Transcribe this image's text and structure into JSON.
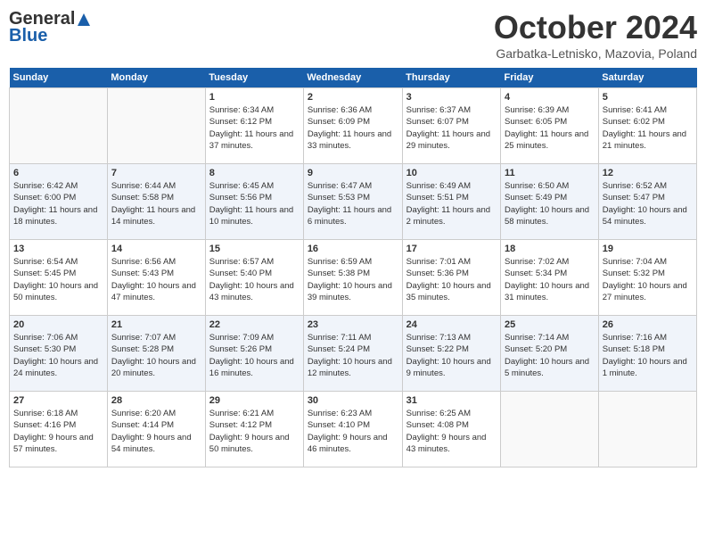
{
  "header": {
    "logo_general": "General",
    "logo_blue": "Blue",
    "month_title": "October 2024",
    "location": "Garbatka-Letnisko, Mazovia, Poland"
  },
  "days_of_week": [
    "Sunday",
    "Monday",
    "Tuesday",
    "Wednesday",
    "Thursday",
    "Friday",
    "Saturday"
  ],
  "weeks": [
    [
      {
        "num": "",
        "sunrise": "",
        "sunset": "",
        "daylight": ""
      },
      {
        "num": "",
        "sunrise": "",
        "sunset": "",
        "daylight": ""
      },
      {
        "num": "1",
        "sunrise": "Sunrise: 6:34 AM",
        "sunset": "Sunset: 6:12 PM",
        "daylight": "Daylight: 11 hours and 37 minutes."
      },
      {
        "num": "2",
        "sunrise": "Sunrise: 6:36 AM",
        "sunset": "Sunset: 6:09 PM",
        "daylight": "Daylight: 11 hours and 33 minutes."
      },
      {
        "num": "3",
        "sunrise": "Sunrise: 6:37 AM",
        "sunset": "Sunset: 6:07 PM",
        "daylight": "Daylight: 11 hours and 29 minutes."
      },
      {
        "num": "4",
        "sunrise": "Sunrise: 6:39 AM",
        "sunset": "Sunset: 6:05 PM",
        "daylight": "Daylight: 11 hours and 25 minutes."
      },
      {
        "num": "5",
        "sunrise": "Sunrise: 6:41 AM",
        "sunset": "Sunset: 6:02 PM",
        "daylight": "Daylight: 11 hours and 21 minutes."
      }
    ],
    [
      {
        "num": "6",
        "sunrise": "Sunrise: 6:42 AM",
        "sunset": "Sunset: 6:00 PM",
        "daylight": "Daylight: 11 hours and 18 minutes."
      },
      {
        "num": "7",
        "sunrise": "Sunrise: 6:44 AM",
        "sunset": "Sunset: 5:58 PM",
        "daylight": "Daylight: 11 hours and 14 minutes."
      },
      {
        "num": "8",
        "sunrise": "Sunrise: 6:45 AM",
        "sunset": "Sunset: 5:56 PM",
        "daylight": "Daylight: 11 hours and 10 minutes."
      },
      {
        "num": "9",
        "sunrise": "Sunrise: 6:47 AM",
        "sunset": "Sunset: 5:53 PM",
        "daylight": "Daylight: 11 hours and 6 minutes."
      },
      {
        "num": "10",
        "sunrise": "Sunrise: 6:49 AM",
        "sunset": "Sunset: 5:51 PM",
        "daylight": "Daylight: 11 hours and 2 minutes."
      },
      {
        "num": "11",
        "sunrise": "Sunrise: 6:50 AM",
        "sunset": "Sunset: 5:49 PM",
        "daylight": "Daylight: 10 hours and 58 minutes."
      },
      {
        "num": "12",
        "sunrise": "Sunrise: 6:52 AM",
        "sunset": "Sunset: 5:47 PM",
        "daylight": "Daylight: 10 hours and 54 minutes."
      }
    ],
    [
      {
        "num": "13",
        "sunrise": "Sunrise: 6:54 AM",
        "sunset": "Sunset: 5:45 PM",
        "daylight": "Daylight: 10 hours and 50 minutes."
      },
      {
        "num": "14",
        "sunrise": "Sunrise: 6:56 AM",
        "sunset": "Sunset: 5:43 PM",
        "daylight": "Daylight: 10 hours and 47 minutes."
      },
      {
        "num": "15",
        "sunrise": "Sunrise: 6:57 AM",
        "sunset": "Sunset: 5:40 PM",
        "daylight": "Daylight: 10 hours and 43 minutes."
      },
      {
        "num": "16",
        "sunrise": "Sunrise: 6:59 AM",
        "sunset": "Sunset: 5:38 PM",
        "daylight": "Daylight: 10 hours and 39 minutes."
      },
      {
        "num": "17",
        "sunrise": "Sunrise: 7:01 AM",
        "sunset": "Sunset: 5:36 PM",
        "daylight": "Daylight: 10 hours and 35 minutes."
      },
      {
        "num": "18",
        "sunrise": "Sunrise: 7:02 AM",
        "sunset": "Sunset: 5:34 PM",
        "daylight": "Daylight: 10 hours and 31 minutes."
      },
      {
        "num": "19",
        "sunrise": "Sunrise: 7:04 AM",
        "sunset": "Sunset: 5:32 PM",
        "daylight": "Daylight: 10 hours and 27 minutes."
      }
    ],
    [
      {
        "num": "20",
        "sunrise": "Sunrise: 7:06 AM",
        "sunset": "Sunset: 5:30 PM",
        "daylight": "Daylight: 10 hours and 24 minutes."
      },
      {
        "num": "21",
        "sunrise": "Sunrise: 7:07 AM",
        "sunset": "Sunset: 5:28 PM",
        "daylight": "Daylight: 10 hours and 20 minutes."
      },
      {
        "num": "22",
        "sunrise": "Sunrise: 7:09 AM",
        "sunset": "Sunset: 5:26 PM",
        "daylight": "Daylight: 10 hours and 16 minutes."
      },
      {
        "num": "23",
        "sunrise": "Sunrise: 7:11 AM",
        "sunset": "Sunset: 5:24 PM",
        "daylight": "Daylight: 10 hours and 12 minutes."
      },
      {
        "num": "24",
        "sunrise": "Sunrise: 7:13 AM",
        "sunset": "Sunset: 5:22 PM",
        "daylight": "Daylight: 10 hours and 9 minutes."
      },
      {
        "num": "25",
        "sunrise": "Sunrise: 7:14 AM",
        "sunset": "Sunset: 5:20 PM",
        "daylight": "Daylight: 10 hours and 5 minutes."
      },
      {
        "num": "26",
        "sunrise": "Sunrise: 7:16 AM",
        "sunset": "Sunset: 5:18 PM",
        "daylight": "Daylight: 10 hours and 1 minute."
      }
    ],
    [
      {
        "num": "27",
        "sunrise": "Sunrise: 6:18 AM",
        "sunset": "Sunset: 4:16 PM",
        "daylight": "Daylight: 9 hours and 57 minutes."
      },
      {
        "num": "28",
        "sunrise": "Sunrise: 6:20 AM",
        "sunset": "Sunset: 4:14 PM",
        "daylight": "Daylight: 9 hours and 54 minutes."
      },
      {
        "num": "29",
        "sunrise": "Sunrise: 6:21 AM",
        "sunset": "Sunset: 4:12 PM",
        "daylight": "Daylight: 9 hours and 50 minutes."
      },
      {
        "num": "30",
        "sunrise": "Sunrise: 6:23 AM",
        "sunset": "Sunset: 4:10 PM",
        "daylight": "Daylight: 9 hours and 46 minutes."
      },
      {
        "num": "31",
        "sunrise": "Sunrise: 6:25 AM",
        "sunset": "Sunset: 4:08 PM",
        "daylight": "Daylight: 9 hours and 43 minutes."
      },
      {
        "num": "",
        "sunrise": "",
        "sunset": "",
        "daylight": ""
      },
      {
        "num": "",
        "sunrise": "",
        "sunset": "",
        "daylight": ""
      }
    ]
  ]
}
